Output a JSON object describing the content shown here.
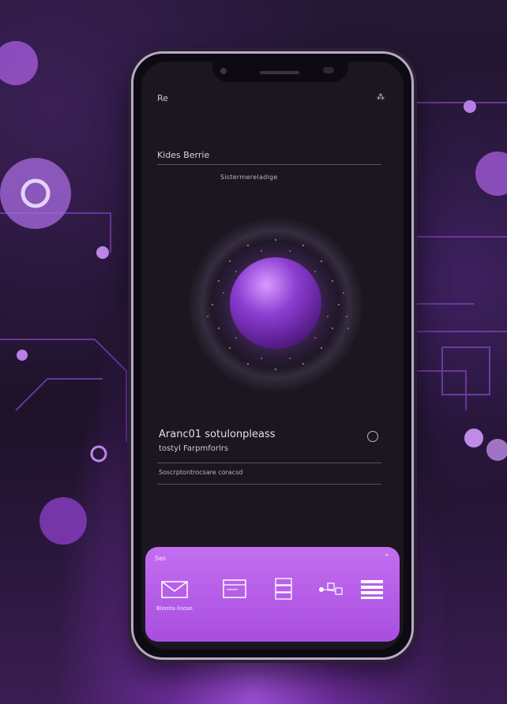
{
  "status": {
    "left": "Re",
    "right": "⁂"
  },
  "header": {
    "title": "Kides Berrie",
    "subtitle": "Sistermereladige"
  },
  "info": {
    "title": "Aranc01 sotulonpleass",
    "subtitle": "tostyl Farpmforlrs",
    "line": "Soscrptontrocsare coracsd"
  },
  "dock": {
    "label_left": "Ses",
    "label_right": "⌃",
    "items": [
      {
        "icon": "envelope-icon",
        "label": "Bleotis-lisose"
      },
      {
        "icon": "browser-window-icon",
        "label": ""
      },
      {
        "icon": "server-stack-icon",
        "label": ""
      },
      {
        "icon": "network-nodes-icon",
        "label": ""
      },
      {
        "icon": "menu-lines-icon",
        "label": ""
      }
    ]
  },
  "colors": {
    "accent": "#b45ee8",
    "background": "#1c1226",
    "screen": "#1b1620"
  }
}
